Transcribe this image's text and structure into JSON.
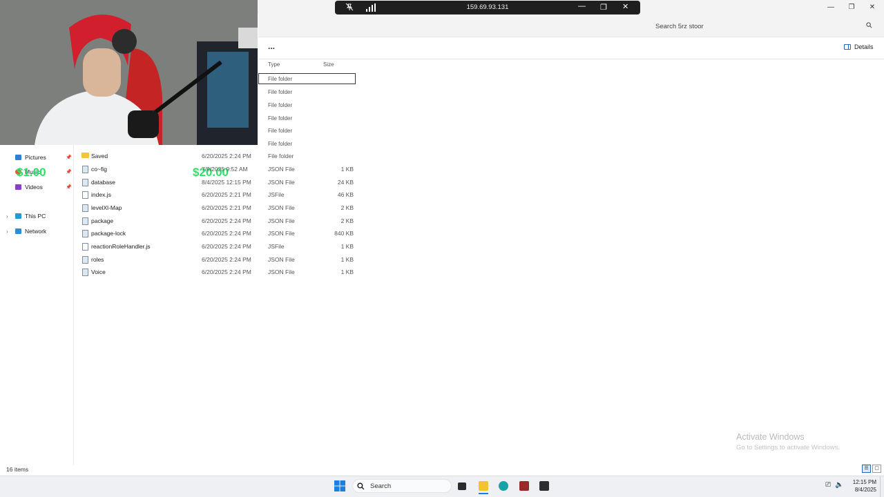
{
  "window": {
    "search_placeholder": "Search 5rz stoor",
    "more_label": "...",
    "details_label": "Details",
    "minimize_glyph": "—",
    "maximize_glyph": "❐",
    "close_glyph": "✕"
  },
  "remote_session": {
    "ip": "159.69.93.131",
    "icons": [
      "unpin-icon",
      "signal-bars-icon",
      "minimize-icon",
      "restore-icon",
      "close-icon"
    ]
  },
  "columns": {
    "type": "Type",
    "size": "Size"
  },
  "hidden_rows_types": [
    "File folder",
    "File folder",
    "File folder",
    "File folder",
    "File folder",
    "File folder"
  ],
  "files": [
    {
      "name": "Saved",
      "date": "6/20/2025 2:24 PM",
      "type": "File folder",
      "size": "",
      "icon": "folder-icon"
    },
    {
      "name": "co~fig",
      "date": "7/9/2025 9:52 AM",
      "type": "JSON File",
      "size": "1 KB",
      "icon": "json-file-icon"
    },
    {
      "name": "database",
      "date": "8/4/2025 12:15 PM",
      "type": "JSON File",
      "size": "24 KB",
      "icon": "json-file-icon"
    },
    {
      "name": "index.js",
      "date": "6/20/2025 2:21 PM",
      "type": "JSFile",
      "size": "46 KB",
      "icon": "js-file-icon"
    },
    {
      "name": "levelXl-Map",
      "date": "6/20/2025 2:21 PM",
      "type": "JSON File",
      "size": "2 KB",
      "icon": "json-file-icon"
    },
    {
      "name": "package",
      "date": "6/20/2025 2:24 PM",
      "type": "JSON File",
      "size": "2 KB",
      "icon": "json-file-icon"
    },
    {
      "name": "package-lock",
      "date": "6/20/2025 2:24 PM",
      "type": "JSON File",
      "size": "840 KB",
      "icon": "json-file-icon"
    },
    {
      "name": "reactionRoleHandler.js",
      "date": "6/20/2025 2:24 PM",
      "type": "JSFile",
      "size": "1 KB",
      "icon": "js-file-icon"
    },
    {
      "name": "roles",
      "date": "6/20/2025 2:24 PM",
      "type": "JSON File",
      "size": "1 KB",
      "icon": "json-file-icon"
    },
    {
      "name": "Voice",
      "date": "6/20/2025 2:24 PM",
      "type": "JSON File",
      "size": "1 KB",
      "icon": "json-file-icon"
    }
  ],
  "sidebar": {
    "quick_access": [
      {
        "label": "Pictures",
        "color": "#2f7fd6"
      },
      {
        "label": "Music",
        "color": "#e65a2e"
      },
      {
        "label": "Videos",
        "color": "#8b3ec7"
      }
    ],
    "this_pc": "This PC",
    "network": "Network"
  },
  "overlay": {
    "amount_left": "$1.00",
    "amount_right": "$20.00",
    "amount_color": "#2ee06a"
  },
  "status": {
    "item_count": "16 items"
  },
  "watermark": {
    "title": "Activate Windows",
    "subtitle": "Go to Settings to activate Windows."
  },
  "taskbar": {
    "search_label": "Search",
    "time": "12:15 PM",
    "date": "8/4/2025"
  }
}
